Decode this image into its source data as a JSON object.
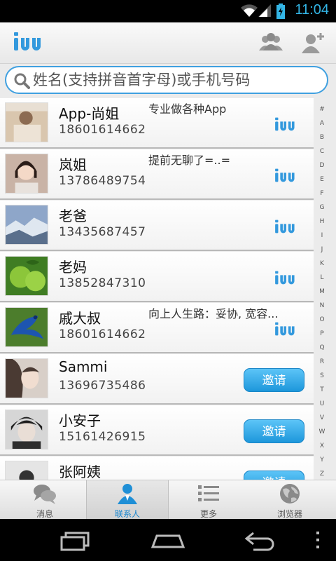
{
  "status_bar": {
    "time": "11:04"
  },
  "header": {
    "logo_text": "iUU"
  },
  "search": {
    "placeholder": "姓名(支持拼音首字母)或手机号码"
  },
  "contacts": [
    {
      "name": "App-尚姐",
      "phone": "18601614662",
      "status": "专业做各种App",
      "action": "logo"
    },
    {
      "name": "岚姐",
      "phone": "13786489754",
      "status": "提前无聊了=..=",
      "action": "logo"
    },
    {
      "name": "老爸",
      "phone": "13435687457",
      "status": "",
      "action": "logo"
    },
    {
      "name": "老妈",
      "phone": "13852847310",
      "status": "",
      "action": "logo"
    },
    {
      "name": "戚大叔",
      "phone": "18601614662",
      "status": "向上人生路：妥协, 宽容...",
      "action": "logo"
    },
    {
      "name": "Sammi",
      "phone": "13696735486",
      "status": "",
      "action": "invite"
    },
    {
      "name": "小安子",
      "phone": "15161426915",
      "status": "",
      "action": "invite"
    },
    {
      "name": "张阿姨",
      "phone": "",
      "status": "",
      "action": "invite"
    }
  ],
  "invite_label": "邀请",
  "alphabet_index": [
    "#",
    "A",
    "B",
    "C",
    "D",
    "E",
    "F",
    "G",
    "H",
    "I",
    "J",
    "K",
    "L",
    "M",
    "N",
    "O",
    "P",
    "Q",
    "R",
    "S",
    "T",
    "U",
    "V",
    "W",
    "X",
    "Y",
    "Z"
  ],
  "tabs": [
    {
      "label": "消息",
      "icon": "chat-bubbles-icon",
      "active": false
    },
    {
      "label": "联系人",
      "icon": "person-icon",
      "active": true
    },
    {
      "label": "更多",
      "icon": "list-icon",
      "active": false
    },
    {
      "label": "浏览器",
      "icon": "globe-icon",
      "active": false
    }
  ],
  "colors": {
    "accent": "#1a87cf",
    "search_border": "#3fa0e0",
    "status_time": "#33b5e5"
  }
}
